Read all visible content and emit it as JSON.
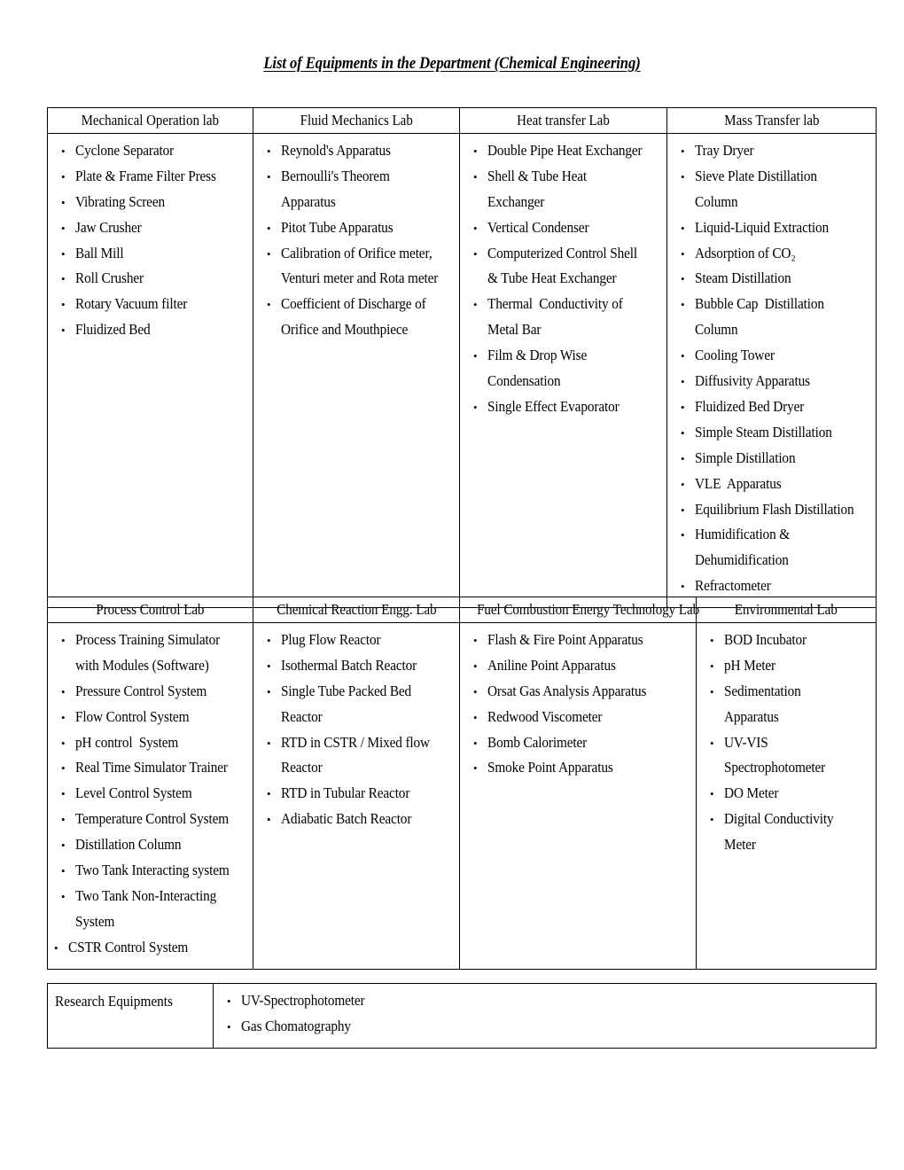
{
  "document": {
    "title": "List of Equipments in the Department (Chemical Engineering)"
  },
  "table_labs_1": {
    "headers": [
      "Mechanical Operation lab",
      "Fluid Mechanics Lab",
      "Heat transfer Lab",
      "Mass Transfer lab"
    ],
    "columns": [
      [
        "Cyclone Separator",
        "Plate & Frame Filter Press",
        "Vibrating Screen",
        "Jaw Crusher",
        "Ball Mill",
        "Roll Crusher",
        "Rotary Vacuum filter",
        "Fluidized Bed"
      ],
      [
        "Reynold's Apparatus",
        "Bernoulli's Theorem Apparatus",
        "Pitot Tube Apparatus",
        "Calibration of Orifice meter, Venturi meter and Rota meter",
        "Coefficient of Discharge of Orifice and Mouthpiece"
      ],
      [
        "Double Pipe Heat Exchanger",
        "Shell & Tube Heat Exchanger",
        "Vertical Condenser",
        "Computerized Control Shell & Tube Heat Exchanger",
        "Thermal  Conductivity of Metal Bar",
        "Film & Drop Wise Condensation",
        "Single Effect Evaporator"
      ],
      [
        "Tray Dryer",
        "Sieve Plate Distillation Column",
        "Liquid-Liquid Extraction",
        "Adsorption of CO₂",
        "Steam Distillation",
        "Bubble Cap  Distillation Column",
        "Cooling Tower",
        "Diffusivity Apparatus",
        "Fluidized Bed Dryer",
        "Simple Steam Distillation",
        "Simple Distillation",
        "VLE  Apparatus",
        "Equilibrium Flash Distillation",
        "Humidification & Dehumidification",
        "Refractometer"
      ]
    ]
  },
  "table_labs_2": {
    "headers": [
      "Process Control Lab",
      "Chemical Reaction Engg. Lab",
      "Fuel Combustion Energy Technology Lab",
      "Environmental Lab"
    ],
    "columns": [
      [
        "Process Training Simulator with Modules (Software)",
        "Pressure Control System",
        "Flow Control System",
        "pH control  System",
        "Real Time Simulator Trainer",
        "Level Control System",
        "Temperature Control System",
        "Distillation Column",
        "Two Tank Interacting system",
        "Two Tank Non-Interacting System",
        "CSTR Control System"
      ],
      [
        "Plug Flow Reactor",
        "Isothermal Batch Reactor",
        "Single Tube Packed Bed Reactor",
        "RTD in CSTR / Mixed flow Reactor",
        "RTD in Tubular Reactor",
        "Adiabatic Batch Reactor"
      ],
      [
        "Flash & Fire Point Apparatus",
        "Aniline Point Apparatus",
        "Orsat Gas Analysis Apparatus",
        "Redwood Viscometer",
        "Bomb Calorimeter",
        "Smoke Point Apparatus"
      ],
      [
        "BOD Incubator",
        "pH Meter",
        "Sedimentation Apparatus",
        "UV-VIS Spectrophotometer",
        "DO Meter",
        "Digital Conductivity Meter"
      ]
    ]
  },
  "table_research": {
    "label": "Research Equipments",
    "items": [
      "UV-Spectrophotometer",
      "Gas Chomatography"
    ]
  },
  "colors": {
    "text": "#000000",
    "border": "#000000",
    "background": "#ffffff"
  }
}
